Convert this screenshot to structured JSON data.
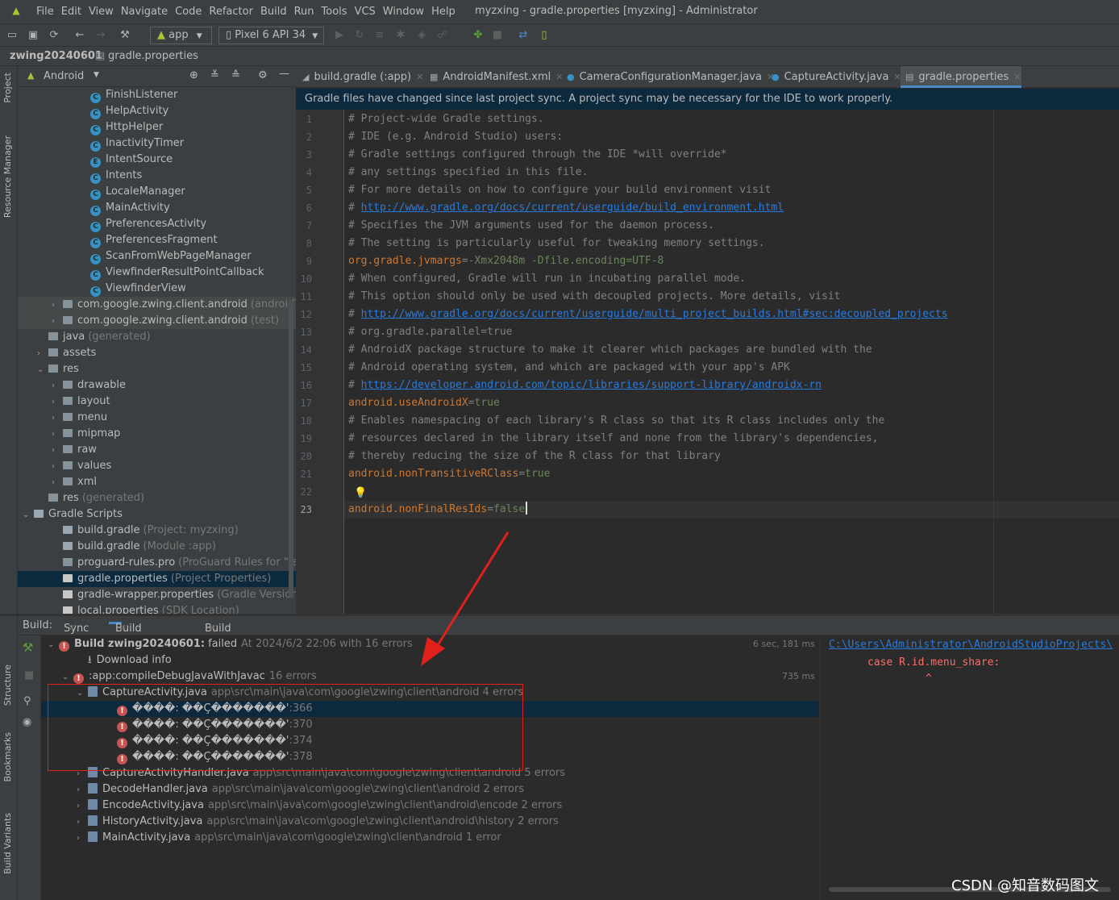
{
  "menubar": {
    "items": [
      "File",
      "Edit",
      "View",
      "Navigate",
      "Code",
      "Refactor",
      "Build",
      "Run",
      "Tools",
      "VCS",
      "Window",
      "Help"
    ],
    "window_title": "myzxing - gradle.properties [myzxing] - Administrator"
  },
  "toolbar": {
    "config_label": "app",
    "device_label": "Pixel 6 API 34"
  },
  "breadcrumb": {
    "project": "zwing20240601",
    "file": "gradle.properties"
  },
  "side_tabs": [
    "Project",
    "Resource Manager",
    "Structure",
    "Bookmarks",
    "Build Variants"
  ],
  "project_panel": {
    "view_selector": "Android",
    "rows": [
      {
        "indent": 76,
        "icon": "class",
        "label": "FinishListener",
        "extra": ""
      },
      {
        "indent": 76,
        "icon": "class",
        "label": "HelpActivity",
        "extra": ""
      },
      {
        "indent": 76,
        "icon": "class",
        "label": "HttpHelper",
        "extra": ""
      },
      {
        "indent": 76,
        "icon": "class",
        "label": "InactivityTimer",
        "extra": ""
      },
      {
        "indent": 76,
        "icon": "enum",
        "label": "IntentSource",
        "extra": ""
      },
      {
        "indent": 76,
        "icon": "class",
        "label": "Intents",
        "extra": ""
      },
      {
        "indent": 76,
        "icon": "class",
        "label": "LocaleManager",
        "extra": ""
      },
      {
        "indent": 76,
        "icon": "class",
        "label": "MainActivity",
        "extra": ""
      },
      {
        "indent": 76,
        "icon": "class",
        "label": "PreferencesActivity",
        "extra": ""
      },
      {
        "indent": 76,
        "icon": "class",
        "label": "PreferencesFragment",
        "extra": ""
      },
      {
        "indent": 76,
        "icon": "class",
        "label": "ScanFromWebPageManager",
        "extra": ""
      },
      {
        "indent": 76,
        "icon": "class",
        "label": "ViewfinderResultPointCallback",
        "extra": ""
      },
      {
        "indent": 76,
        "icon": "class",
        "label": "ViewfinderView",
        "extra": ""
      },
      {
        "indent": 42,
        "icon": "folder",
        "arrow": "›",
        "label": "com.google.zwing.client.android",
        "extra": "(androidTest)"
      },
      {
        "indent": 42,
        "icon": "folder",
        "arrow": "›",
        "label": "com.google.zwing.client.android",
        "extra": "(test)"
      },
      {
        "indent": 24,
        "icon": "folder",
        "label": "java",
        "extra": "(generated)"
      },
      {
        "indent": 24,
        "icon": "folder",
        "arrow": "›",
        "label": "assets",
        "extra": ""
      },
      {
        "indent": 24,
        "icon": "folder",
        "arrow": "⌄",
        "label": "res",
        "extra": ""
      },
      {
        "indent": 42,
        "icon": "folder",
        "arrow": "›",
        "label": "drawable",
        "extra": ""
      },
      {
        "indent": 42,
        "icon": "folder",
        "arrow": "›",
        "label": "layout",
        "extra": ""
      },
      {
        "indent": 42,
        "icon": "folder",
        "arrow": "›",
        "label": "menu",
        "extra": ""
      },
      {
        "indent": 42,
        "icon": "folder",
        "arrow": "›",
        "label": "mipmap",
        "extra": ""
      },
      {
        "indent": 42,
        "icon": "folder",
        "arrow": "›",
        "label": "raw",
        "extra": ""
      },
      {
        "indent": 42,
        "icon": "folder",
        "arrow": "›",
        "label": "values",
        "extra": ""
      },
      {
        "indent": 42,
        "icon": "folder",
        "arrow": "›",
        "label": "xml",
        "extra": ""
      },
      {
        "indent": 24,
        "icon": "folder",
        "label": "res",
        "extra": "(generated)"
      },
      {
        "indent": 6,
        "icon": "gradle",
        "arrow": "⌄",
        "label": "Gradle Scripts",
        "extra": ""
      },
      {
        "indent": 42,
        "icon": "gradle",
        "label": "build.gradle",
        "extra": "(Project: myzxing)"
      },
      {
        "indent": 42,
        "icon": "gradle",
        "label": "build.gradle",
        "extra": "(Module :app)"
      },
      {
        "indent": 42,
        "icon": "file",
        "label": "proguard-rules.pro",
        "extra": "(ProGuard Rules for \":app\")"
      },
      {
        "indent": 42,
        "icon": "props",
        "label": "gradle.properties",
        "extra": "(Project Properties)"
      },
      {
        "indent": 42,
        "icon": "props",
        "label": "gradle-wrapper.properties",
        "extra": "(Gradle Version)"
      },
      {
        "indent": 42,
        "icon": "props",
        "label": "local.properties",
        "extra": "(SDK Location)"
      }
    ]
  },
  "editor_tabs": [
    {
      "label": "build.gradle (:app)"
    },
    {
      "label": "AndroidManifest.xml"
    },
    {
      "label": "CameraConfigurationManager.java"
    },
    {
      "label": "CaptureActivity.java"
    },
    {
      "label": "gradle.properties"
    }
  ],
  "notice": "Gradle files have changed since last project sync. A project sync may be necessary for the IDE to work properly.",
  "code_lines": [
    {
      "n": "1",
      "parts": [
        {
          "t": "cm",
          "s": "# Project-wide Gradle settings."
        }
      ]
    },
    {
      "n": "2",
      "parts": [
        {
          "t": "cm",
          "s": "# IDE (e.g. Android Studio) users:"
        }
      ]
    },
    {
      "n": "3",
      "parts": [
        {
          "t": "cm",
          "s": "# Gradle settings configured through the IDE *will override*"
        }
      ]
    },
    {
      "n": "4",
      "parts": [
        {
          "t": "cm",
          "s": "# any settings specified in this file."
        }
      ]
    },
    {
      "n": "5",
      "parts": [
        {
          "t": "cm",
          "s": "# For more details on how to configure your build environment visit"
        }
      ]
    },
    {
      "n": "6",
      "parts": [
        {
          "t": "cm",
          "s": "# "
        },
        {
          "t": "url",
          "s": "http://www.gradle.org/docs/current/userguide/build_environment.html"
        }
      ]
    },
    {
      "n": "7",
      "parts": [
        {
          "t": "cm",
          "s": "# Specifies the JVM arguments used for the daemon process."
        }
      ]
    },
    {
      "n": "8",
      "parts": [
        {
          "t": "cm",
          "s": "# The setting is particularly useful for tweaking memory settings."
        }
      ]
    },
    {
      "n": "9",
      "parts": [
        {
          "t": "key",
          "s": "org.gradle.jvmargs"
        },
        {
          "t": "cm",
          "s": "="
        },
        {
          "t": "val",
          "s": "-Xmx2048m -Dfile.encoding=UTF-8"
        }
      ]
    },
    {
      "n": "10",
      "parts": [
        {
          "t": "cm",
          "s": "# When configured, Gradle will run in incubating parallel mode."
        }
      ]
    },
    {
      "n": "11",
      "parts": [
        {
          "t": "cm",
          "s": "# This option should only be used with decoupled projects. More details, visit"
        }
      ]
    },
    {
      "n": "12",
      "parts": [
        {
          "t": "cm",
          "s": "# "
        },
        {
          "t": "url",
          "s": "http://www.gradle.org/docs/current/userguide/multi_project_builds.html#sec:decoupled_projects"
        }
      ]
    },
    {
      "n": "13",
      "parts": [
        {
          "t": "cm",
          "s": "# org.gradle.parallel=true"
        }
      ]
    },
    {
      "n": "14",
      "parts": [
        {
          "t": "cm",
          "s": "# AndroidX package structure to make it clearer which packages are bundled with the"
        }
      ]
    },
    {
      "n": "15",
      "parts": [
        {
          "t": "cm",
          "s": "# Android operating system, and which are packaged with your app's APK"
        }
      ]
    },
    {
      "n": "16",
      "parts": [
        {
          "t": "cm",
          "s": "# "
        },
        {
          "t": "url",
          "s": "https://developer.android.com/topic/libraries/support-library/androidx-rn"
        }
      ]
    },
    {
      "n": "17",
      "parts": [
        {
          "t": "key",
          "s": "android.useAndroidX"
        },
        {
          "t": "cm",
          "s": "="
        },
        {
          "t": "val",
          "s": "true"
        }
      ]
    },
    {
      "n": "18",
      "parts": [
        {
          "t": "cm",
          "s": "# Enables namespacing of each library's R class so that its R class includes only the"
        }
      ]
    },
    {
      "n": "19",
      "parts": [
        {
          "t": "cm",
          "s": "# resources declared in the library itself and none from the library's dependencies,"
        }
      ]
    },
    {
      "n": "20",
      "parts": [
        {
          "t": "cm",
          "s": "# thereby reducing the size of the R class for that library"
        }
      ]
    },
    {
      "n": "21",
      "parts": [
        {
          "t": "key",
          "s": "android.nonTransitiveRClass"
        },
        {
          "t": "cm",
          "s": "="
        },
        {
          "t": "val",
          "s": "true"
        }
      ]
    },
    {
      "n": "22",
      "parts": []
    },
    {
      "n": "23",
      "parts": [
        {
          "t": "key",
          "s": "android.nonFinalResIds"
        },
        {
          "t": "cm",
          "s": "="
        },
        {
          "t": "val",
          "s": "false"
        }
      ]
    }
  ],
  "build_panel": {
    "label": "Build:",
    "tabs": [
      "Sync",
      "Build Output",
      "Build Analyzer"
    ],
    "rows": [
      {
        "indent": 8,
        "arrow": "⌄",
        "icon": "error",
        "label": "Build zwing20240601:",
        "extra": "failed",
        "dim": "At 2024/6/2 22:06 with 16 errors",
        "time": "6 sec, 181 ms"
      },
      {
        "indent": 44,
        "icon": "download",
        "label": "Download info",
        "extra": "",
        "dim": "",
        "time": ""
      },
      {
        "indent": 26,
        "arrow": "⌄",
        "icon": "error",
        "label": ":app:compileDebugJavaWithJavac",
        "extra": "",
        "dim": "16 errors",
        "time": "735 ms"
      },
      {
        "indent": 44,
        "arrow": "⌄",
        "icon": "java",
        "label": "CaptureActivity.java",
        "extra": "",
        "dim": "app\\src\\main\\java\\com\\google\\zwing\\client\\android 4 errors",
        "time": ""
      },
      {
        "indent": 80,
        "icon": "error",
        "label": "����: ��Ç�������'",
        "extra": "",
        "dim": ":366",
        "time": "",
        "sel": true
      },
      {
        "indent": 80,
        "icon": "error",
        "label": "����: ��Ç�������'",
        "extra": "",
        "dim": ":370",
        "time": ""
      },
      {
        "indent": 80,
        "icon": "error",
        "label": "����: ��Ç�������'",
        "extra": "",
        "dim": ":374",
        "time": ""
      },
      {
        "indent": 80,
        "icon": "error",
        "label": "����: ��Ç�������'",
        "extra": "",
        "dim": ":378",
        "time": ""
      },
      {
        "indent": 44,
        "arrow": "›",
        "icon": "java",
        "label": "CaptureActivityHandler.java",
        "extra": "",
        "dim": "app\\src\\main\\java\\com\\google\\zwing\\client\\android 5 errors",
        "time": ""
      },
      {
        "indent": 44,
        "arrow": "›",
        "icon": "java",
        "label": "DecodeHandler.java",
        "extra": "",
        "dim": "app\\src\\main\\java\\com\\google\\zwing\\client\\android 2 errors",
        "time": ""
      },
      {
        "indent": 44,
        "arrow": "›",
        "icon": "java",
        "label": "EncodeActivity.java",
        "extra": "",
        "dim": "app\\src\\main\\java\\com\\google\\zwing\\client\\android\\encode 2 errors",
        "time": ""
      },
      {
        "indent": 44,
        "arrow": "›",
        "icon": "java",
        "label": "HistoryActivity.java",
        "extra": "",
        "dim": "app\\src\\main\\java\\com\\google\\zwing\\client\\android\\history 2 errors",
        "time": ""
      },
      {
        "indent": 44,
        "arrow": "›",
        "icon": "java",
        "label": "MainActivity.java",
        "extra": "",
        "dim": "app\\src\\main\\java\\com\\google\\zwing\\client\\android 1 error",
        "time": ""
      }
    ]
  },
  "console": {
    "path": "C:\\Users\\Administrator\\AndroidStudioProjects\\",
    "code": "case R.id.menu_share:",
    "caret": "^"
  },
  "watermark": "CSDN @知音数码图文",
  "colors": {
    "accent": "#4a88c7",
    "error": "#c75450",
    "annotation": "#e0201a"
  }
}
